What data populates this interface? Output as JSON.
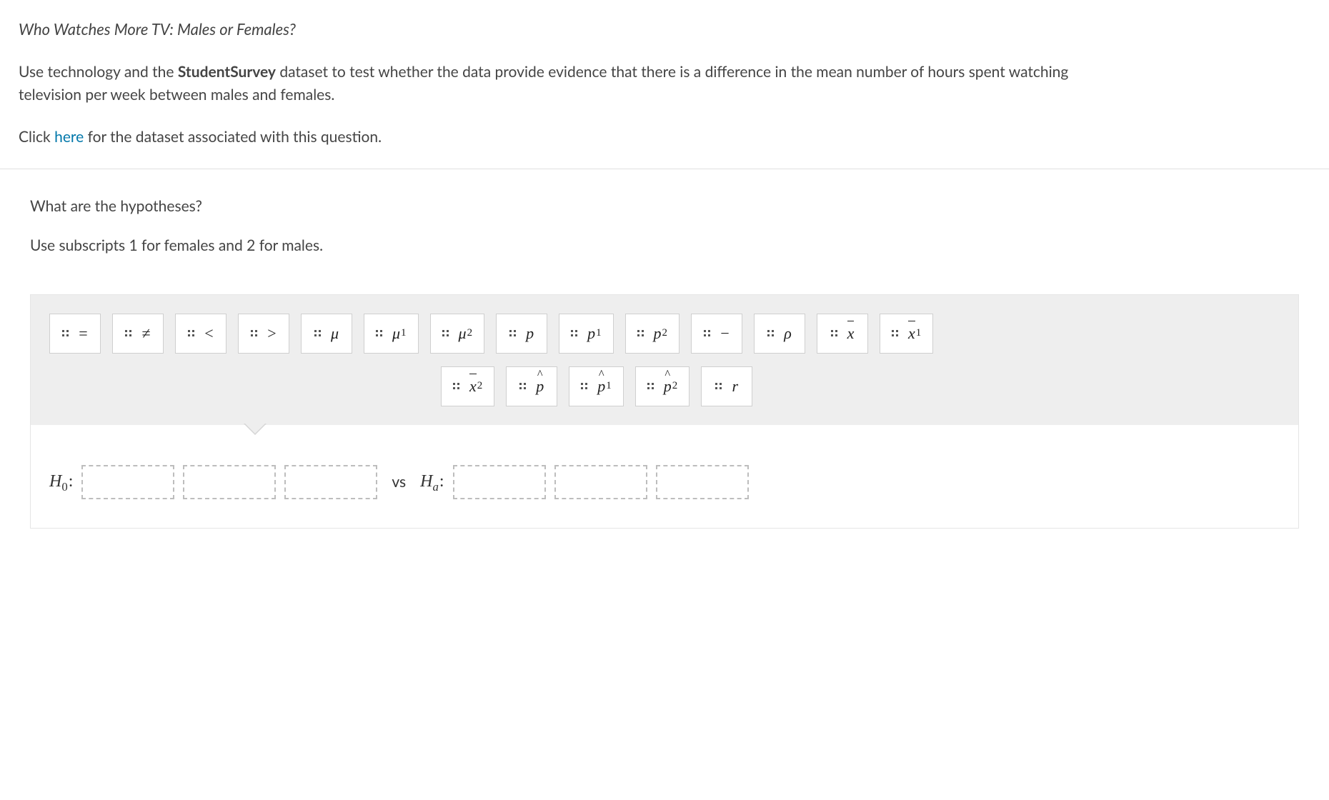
{
  "title": "Who Watches More TV: Males or Females?",
  "intro": {
    "pre": "Use technology and the ",
    "bold": "StudentSurvey",
    "post": " dataset to test whether the data provide evidence that there is a difference in the mean number of hours spent watching television per week between males and females."
  },
  "dataset_line": {
    "pre": "Click ",
    "link": "here",
    "post": " for the dataset associated with this question."
  },
  "question": "What are the hypotheses?",
  "subscript_note": "Use subscripts 1 for females and 2 for males.",
  "tiles_row1": [
    {
      "id": "eq",
      "text": "=",
      "kind": "plain"
    },
    {
      "id": "neq",
      "text": "≠",
      "kind": "plain"
    },
    {
      "id": "lt",
      "text": "<",
      "kind": "plain"
    },
    {
      "id": "gt",
      "text": ">",
      "kind": "plain"
    },
    {
      "id": "mu",
      "text": "μ",
      "kind": "italic"
    },
    {
      "id": "mu1",
      "text": "μ",
      "sub": "1",
      "kind": "italic"
    },
    {
      "id": "mu2",
      "text": "μ",
      "sub": "2",
      "kind": "italic"
    },
    {
      "id": "p",
      "text": "p",
      "kind": "italic"
    },
    {
      "id": "p1",
      "text": "p",
      "sub": "1",
      "kind": "italic"
    },
    {
      "id": "p2",
      "text": "p",
      "sub": "2",
      "kind": "italic"
    },
    {
      "id": "minus",
      "text": "−",
      "kind": "plain"
    },
    {
      "id": "rho",
      "text": "ρ",
      "kind": "italic"
    },
    {
      "id": "xbar",
      "text": "x",
      "kind": "overbar"
    },
    {
      "id": "xbar1",
      "text": "x",
      "sub": "1",
      "kind": "overbar"
    }
  ],
  "tiles_row2": [
    {
      "id": "xbar2",
      "text": "x",
      "sub": "2",
      "kind": "overbar"
    },
    {
      "id": "phat",
      "text": "p",
      "kind": "hat"
    },
    {
      "id": "phat1",
      "text": "p",
      "sub": "1",
      "kind": "hat"
    },
    {
      "id": "phat2",
      "text": "p",
      "sub": "2",
      "kind": "hat"
    },
    {
      "id": "r",
      "text": "r",
      "kind": "italic"
    }
  ],
  "hypothesis": {
    "h0_label": "H",
    "h0_sub": "0",
    "ha_label": "H",
    "ha_sub": "a",
    "vs": "vs",
    "colon": ":"
  }
}
